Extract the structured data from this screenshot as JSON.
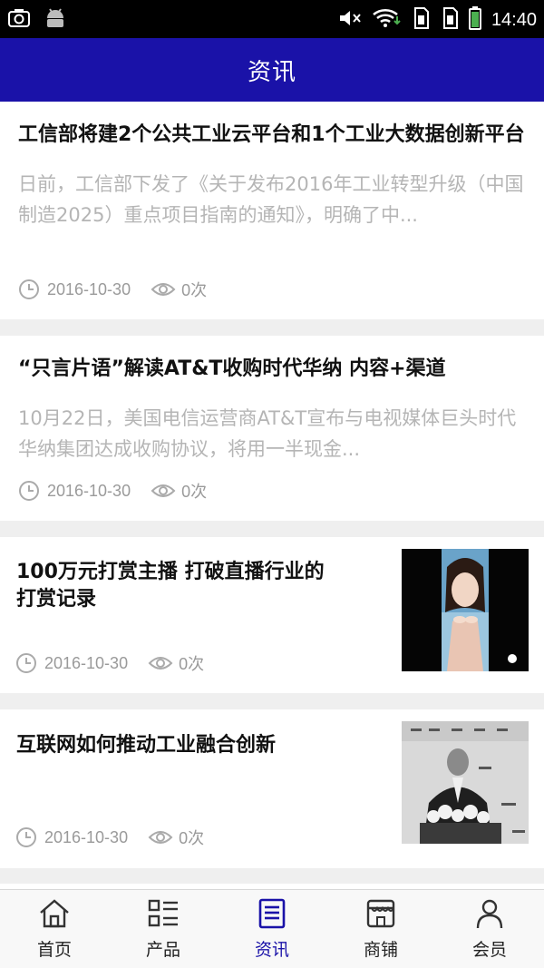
{
  "status_bar": {
    "time": "14:40"
  },
  "header": {
    "title": "资讯"
  },
  "articles": [
    {
      "title": "工信部将建2个公共工业云平台和1个工业大数据创新平台",
      "summary": "日前，工信部下发了《关于发布2016年工业转型升级（中国制造2025）重点项目指南的通知》，明确了中...",
      "date": "2016-10-30",
      "views": "0次"
    },
    {
      "title": "“只言片语”解读AT&T收购时代华纳 内容+渠道",
      "summary": "10月22日，美国电信运营商AT&T宣布与电视媒体巨头时代华纳集团达成收购协议，将用一半现金...",
      "date": "2016-10-30",
      "views": "0次"
    },
    {
      "title_line1": "100万元打赏主播 打破直播行业的",
      "title_line2": "打赏记录",
      "date": "2016-10-30",
      "views": "0次",
      "thumbnail": "live-stream-girl-photo"
    },
    {
      "title": "互联网如何推动工业融合创新",
      "date": "2016-10-30",
      "views": "0次",
      "thumbnail": "conference-speaker-photo"
    }
  ],
  "nav": {
    "items": [
      {
        "label": "首页",
        "icon": "home-icon"
      },
      {
        "label": "产品",
        "icon": "grid-list-icon"
      },
      {
        "label": "资讯",
        "icon": "news-icon"
      },
      {
        "label": "商铺",
        "icon": "shop-icon"
      },
      {
        "label": "会员",
        "icon": "user-icon"
      }
    ],
    "active_index": 2
  },
  "colors": {
    "brand": "#1a12a8",
    "summary_text": "#b5b5b5",
    "meta_text": "#9a9a9a"
  }
}
